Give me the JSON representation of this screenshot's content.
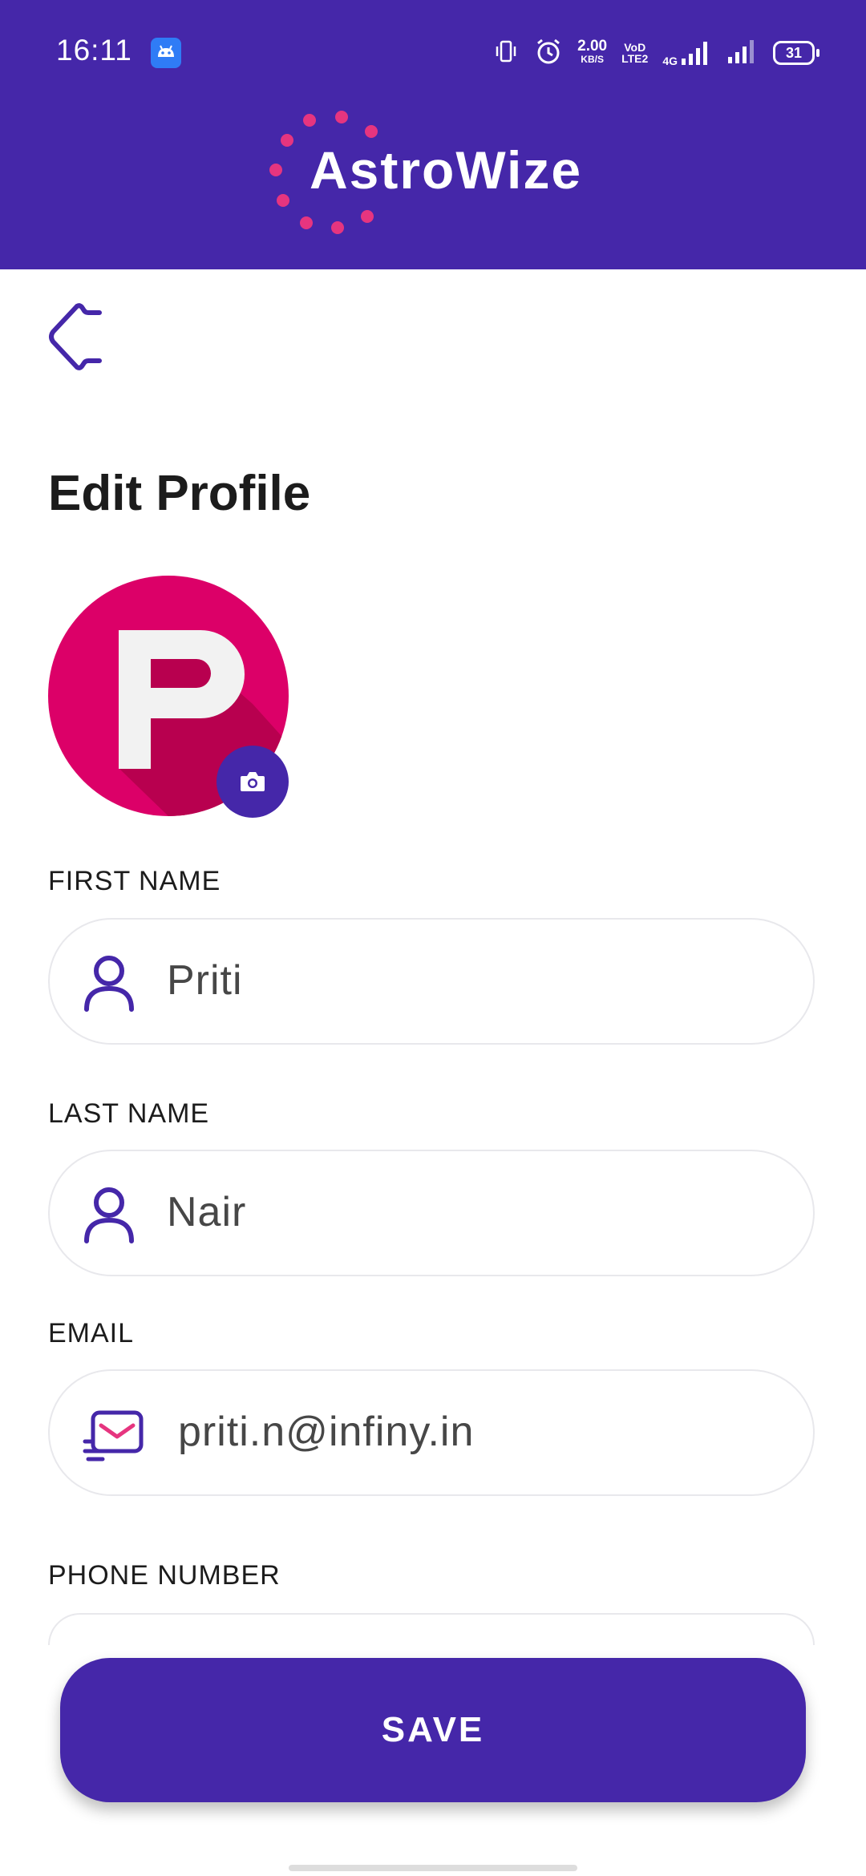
{
  "status_bar": {
    "time": "16:11",
    "net_speed": "2.00",
    "net_speed_unit": "KB/S",
    "volte_top": "VoD",
    "volte_bottom": "LTE2",
    "network_type": "4G",
    "battery": "31"
  },
  "header": {
    "logo_text": "AstroWize",
    "background_color": "#4527a9",
    "logo_dot_color": "#e6357f"
  },
  "page": {
    "title": "Edit Profile"
  },
  "avatar": {
    "letter": "P",
    "background_color": "#dc0068"
  },
  "form": {
    "first_name": {
      "label": "FIRST NAME",
      "value": "Priti",
      "icon": "person-icon"
    },
    "last_name": {
      "label": "LAST NAME",
      "value": "Nair",
      "icon": "person-icon"
    },
    "email": {
      "label": "EMAIL",
      "value": "priti.n@infiny.in",
      "icon": "email-icon"
    },
    "phone": {
      "label": "PHONE NUMBER",
      "value": ""
    }
  },
  "save_button": {
    "label": "SAVE"
  },
  "colors": {
    "accent": "#4527a9",
    "field_border": "#e8e8ec"
  }
}
